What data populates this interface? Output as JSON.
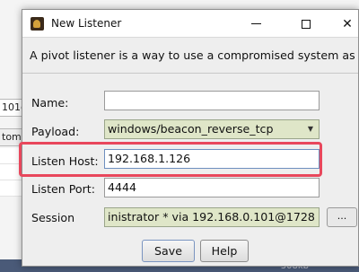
{
  "background": {
    "field1_text": "101@",
    "field2_text": "tomo",
    "status_size": "308kb"
  },
  "dialog": {
    "title": "New Listener",
    "description": "A pivot listener is a way to use a compromised system as"
  },
  "form": {
    "name_label": "Name:",
    "name_value": "",
    "payload_label": "Payload:",
    "payload_value": "windows/beacon_reverse_tcp",
    "host_label": "Listen Host:",
    "host_value": "192.168.1.126",
    "port_label": "Listen Port:",
    "port_value": "4444",
    "session_label": "Session",
    "session_value": "inistrator * via  192.168.0.101@1728",
    "session_browse_label": "..."
  },
  "buttons": {
    "save": "Save",
    "help": "Help"
  },
  "colors": {
    "highlight": "#e8475c",
    "readonly_field": "#dfe6c8"
  },
  "icons": {
    "app": "cobalt-strike-app-icon",
    "minimize": "minimize-icon",
    "maximize": "maximize-icon",
    "close": "close-icon",
    "dropdown": "chevron-down-icon"
  }
}
